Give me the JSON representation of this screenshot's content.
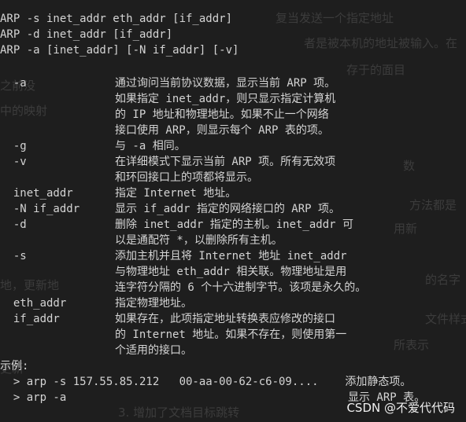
{
  "background_faded_text": [
    "复当发送一个指定地址",
    "者是被本机的地址被输入。在",
    "存于的面目",
    "之前没",
    "中的映射",
    "数",
    "方法都是",
    "用新",
    "的名字",
    "文件样式",
    "所表示",
    "更新",
    "3. 增加了文档目标跳转",
    "地，更新地"
  ],
  "usage_lines": [
    "ARP -s inet_addr eth_addr [if_addr]",
    "ARP -d inet_addr [if_addr]",
    "ARP -a [inet_addr] [-N if_addr] [-v]"
  ],
  "options": [
    {
      "flag": "  -a",
      "desc": [
        "通过询问当前协议数据，显示当前 ARP 项。",
        "如果指定 inet_addr，则只显示指定计算机",
        "的 IP 地址和物理地址。如果不止一个网络",
        "接口使用 ARP，则显示每个 ARP 表的项。"
      ]
    },
    {
      "flag": "  -g",
      "desc": [
        "与 -a 相同。"
      ]
    },
    {
      "flag": "  -v",
      "desc": [
        "在详细模式下显示当前 ARP 项。所有无效项",
        "和环回接口上的项都将显示。"
      ]
    },
    {
      "flag": "  inet_addr",
      "desc": [
        "指定 Internet 地址。"
      ]
    },
    {
      "flag": "  -N if_addr",
      "desc": [
        "显示 if_addr 指定的网络接口的 ARP 项。"
      ]
    },
    {
      "flag": "  -d",
      "desc": [
        "删除 inet_addr 指定的主机。inet_addr 可",
        "以是通配符 *，以删除所有主机。"
      ]
    },
    {
      "flag": "  -s",
      "desc": [
        "添加主机并且将 Internet 地址 inet_addr",
        "与物理地址 eth_addr 相关联。物理地址是用",
        "连字符分隔的 6 个十六进制字节。该项是永久的。"
      ]
    },
    {
      "flag": "  eth_addr",
      "desc": [
        "指定物理地址。"
      ]
    },
    {
      "flag": "  if_addr",
      "desc": [
        "如果存在，此项指定地址转换表应修改的接口",
        "的 Internet 地址。如果不存在，则使用第一",
        "个适用的接口。"
      ]
    }
  ],
  "example_label": "示例:",
  "examples": [
    {
      "cmd": "  > arp -s 157.55.85.212   00-aa-00-62-c6-09....",
      "note": " 添加静态项。"
    },
    {
      "cmd": "  > arp -a",
      "note": "显示 ARP 表。"
    }
  ],
  "watermark": "CSDN @不爱代代码",
  "colors": {
    "background": "#1e1e1e",
    "text": "#d4d4d4",
    "faded": "#3c3c3c"
  }
}
